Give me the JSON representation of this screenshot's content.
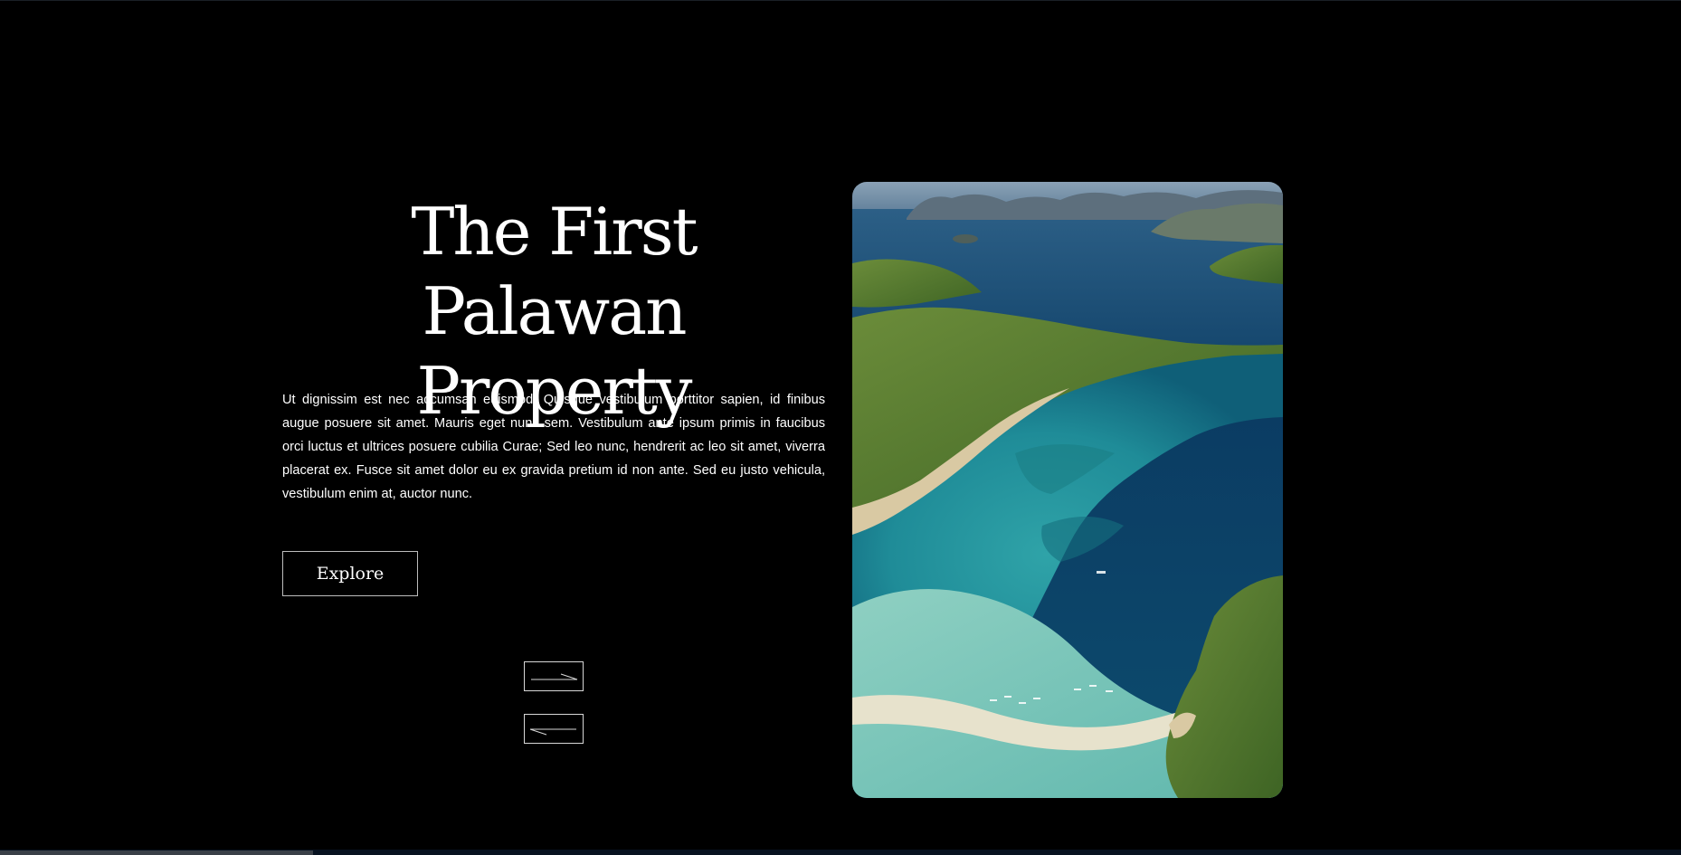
{
  "hero": {
    "title_line1": "The First Palawan",
    "title_line2": "Property",
    "body": "Ut dignissim est nec accumsan euismod. Quisque vestibulum porttitor sapien, id finibus augue posuere sit amet. Mauris eget nunc sem. Vestibulum ante ipsum primis in faucibus orci luctus et ultrices posuere cubilia Curae; Sed leo nunc, hendrerit ac leo sit amet, viverra placerat ex. Fusce sit amet dolor eu ex gravida pretium id non ante. Sed eu justo vehicula, vestibulum enim at, auctor nunc.",
    "explore_label": "Explore"
  },
  "slider": {
    "next_icon": "arrow-right-icon",
    "prev_icon": "arrow-left-icon"
  },
  "image": {
    "subject": "aerial-island-lagoon"
  },
  "colors": {
    "background": "#000000",
    "text": "#ffffff",
    "button_border": "#bdbdbd",
    "sea_deep": "#0b3c63",
    "sea_shallow": "#2fa3a8",
    "island_green": "#4f7a2e"
  }
}
